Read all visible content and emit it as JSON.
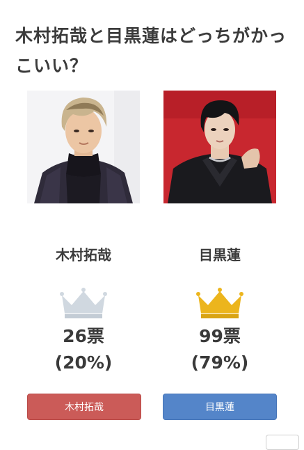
{
  "poll": {
    "title": "木村拓哉と目黒蓮はどっちがかっこいい？"
  },
  "candidates": [
    {
      "name": "木村拓哉",
      "votes": "26票",
      "percent": "(20%)",
      "rank": "2nd",
      "crown_color": "#cfd8e0",
      "button_label": "木村拓哉",
      "button_color": "#cb5b58"
    },
    {
      "name": "目黒蓮",
      "votes": "99票",
      "percent": "(79%)",
      "rank": "1st",
      "crown_color": "#e9b41c",
      "button_label": "目黒蓮",
      "button_color": "#5485c9"
    }
  ],
  "icons": {
    "crown_silver": "crown-icon",
    "crown_gold": "crown-icon"
  }
}
